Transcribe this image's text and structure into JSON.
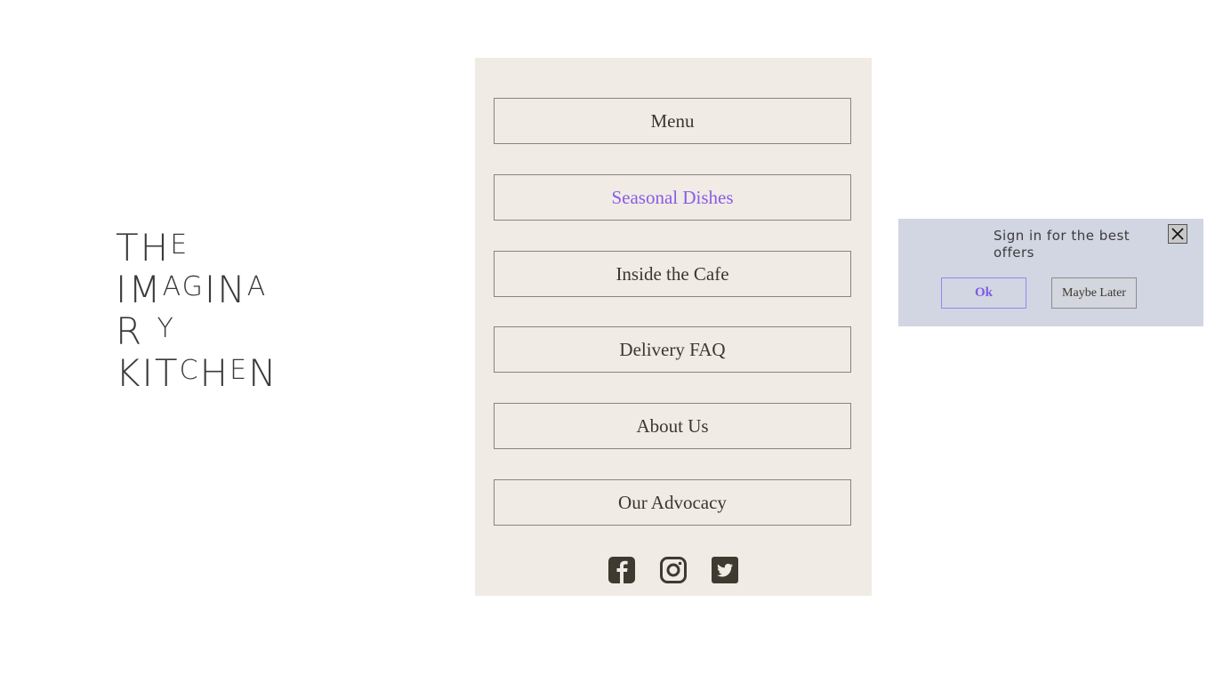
{
  "logo": {
    "lines": [
      "THE",
      "IMAGINA",
      "R Y",
      "KITCHEN"
    ],
    "full_name": "The Imaginary Kitchen"
  },
  "nav": {
    "items": [
      {
        "label": "Menu",
        "active": false
      },
      {
        "label": "Seasonal Dishes",
        "active": true
      },
      {
        "label": "Inside the Cafe",
        "active": false
      },
      {
        "label": "Delivery FAQ",
        "active": false
      },
      {
        "label": "About Us",
        "active": false
      },
      {
        "label": "Our Advocacy",
        "active": false
      }
    ],
    "active_color": "#8a5ce6"
  },
  "socials": [
    {
      "name": "facebook-icon"
    },
    {
      "name": "instagram-icon"
    },
    {
      "name": "twitter-icon"
    }
  ],
  "popup": {
    "message": "Sign in for the best offers",
    "ok_label": "Ok",
    "later_label": "Maybe Later",
    "close_glyph": "✕"
  }
}
